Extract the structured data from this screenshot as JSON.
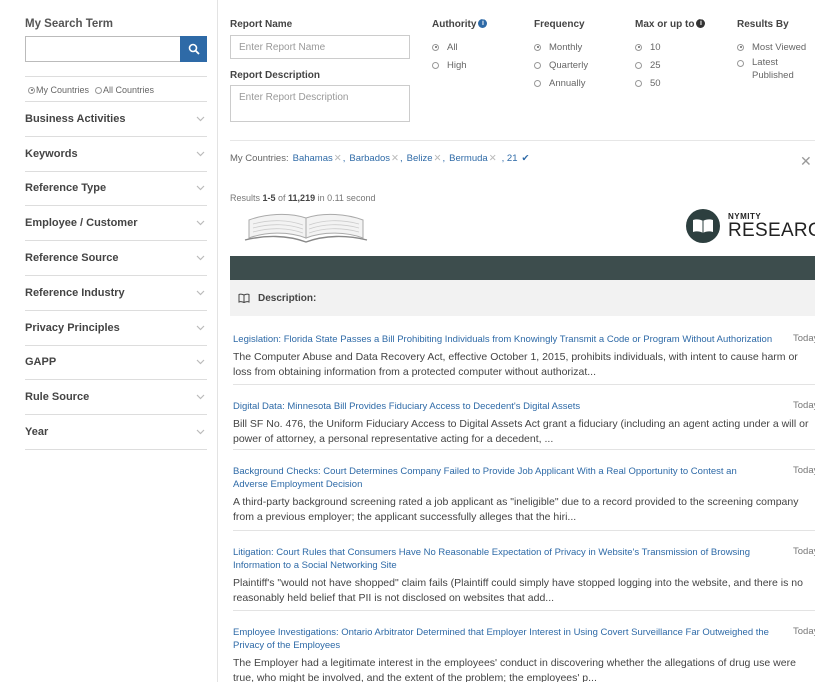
{
  "sidebar": {
    "search_title": "My Search Term",
    "search_value": "",
    "scope_options": [
      "My Countries",
      "All Countries"
    ],
    "items": [
      {
        "label": "Business Activities"
      },
      {
        "label": "Keywords"
      },
      {
        "label": "Reference Type"
      },
      {
        "label": "Employee / Customer"
      },
      {
        "label": "Reference Source"
      },
      {
        "label": "Reference Industry"
      },
      {
        "label": "Privacy Principles"
      },
      {
        "label": "GAPP"
      },
      {
        "label": "Rule Source"
      },
      {
        "label": "Year"
      }
    ]
  },
  "filters": {
    "report_name_label": "Report Name",
    "report_name_placeholder": "Enter Report Name",
    "report_desc_label": "Report Description",
    "report_desc_placeholder": "Enter Report Description",
    "authority": {
      "label": "Authority",
      "options": [
        "All",
        "High"
      ],
      "selected": "All"
    },
    "frequency": {
      "label": "Frequency",
      "options": [
        "Monthly",
        "Quarterly",
        "Annually"
      ],
      "selected": "Monthly"
    },
    "max": {
      "label": "Max or up to",
      "options": [
        "10",
        "25",
        "50"
      ],
      "selected": "10"
    },
    "results_by": {
      "label": "Results By",
      "options": [
        "Most Viewed",
        "Latest",
        "Published"
      ],
      "selected": "Most Viewed"
    }
  },
  "countries": {
    "label": "My Countries:",
    "items": [
      "Bahamas",
      "Barbados",
      "Belize",
      "Bermuda"
    ],
    "more": ", 21"
  },
  "results_summary": {
    "prefix": "Results ",
    "range": "1-5",
    "of": " of ",
    "total": "11,219",
    "suffix": " in 0.11 second"
  },
  "logo": {
    "small": "NYMITY",
    "big": "RESEARCH"
  },
  "table": {
    "description_label": "Description:"
  },
  "results": [
    {
      "title": "Legislation: Florida State Passes a Bill Prohibiting Individuals from Knowingly Transmit a Code or Program Without Authorization",
      "date": "Today",
      "body": "The Computer Abuse and Data Recovery Act, effective October 1, 2015, prohibits individuals, with intent to cause harm or loss from obtaining information from a protected computer without authorizat..."
    },
    {
      "title": "Digital Data: Minnesota Bill Provides Fiduciary Access to Decedent's Digital Assets",
      "date": "Today",
      "body": "Bill SF No. 476, the Uniform Fiduciary Access to Digital Assets Act grant a fiduciary (including an agent acting under a will or power of attorney, a personal representative acting for a decedent, ..."
    },
    {
      "title": "Background Checks: Court Determines Company Failed to Provide Job Applicant With a Real Opportunity to Contest an Adverse Employment Decision",
      "date": "Today",
      "body": "A third-party background screening rated a job applicant as \"ineligible\" due to a record provided to the screening company from a previous employer; the applicant successfully alleges that the hiri..."
    },
    {
      "title": "Litigation: Court Rules that Consumers Have No Reasonable Expectation of Privacy in Website's Transmission of Browsing Information to a Social Networking Site",
      "date": "Today",
      "body": "Plaintiff's \"would not have shopped\" claim fails (Plaintiff could simply have stopped logging into the website, and there is no reasonably held belief that PII is not disclosed on websites that add..."
    },
    {
      "title": "Employee Investigations: Ontario Arbitrator Determined that Employer Interest in Using Covert Surveillance Far Outweighed the Privacy of the Employees",
      "date": "Today",
      "body": "The Employer had a legitimate interest in the employees' conduct in discovering whether the allegations of drug use were true, who might be involved, and the extent of the problem; the employees' p..."
    }
  ]
}
